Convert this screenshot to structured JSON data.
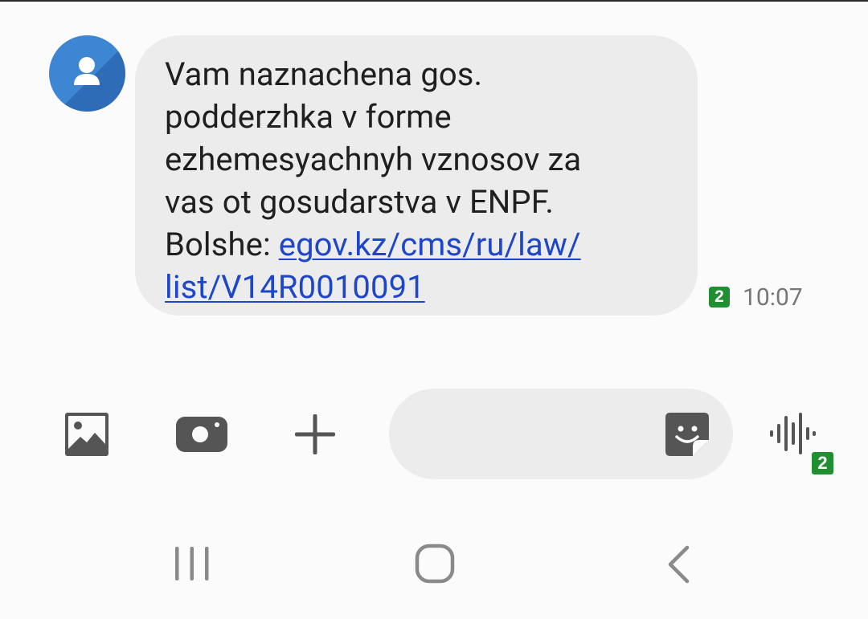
{
  "message": {
    "lines": [
      "Vam naznachena gos.",
      "podderzhka v forme",
      "ezhemesyachnyh vznosov za",
      "vas ot gosudarstva v ENPF."
    ],
    "more_prefix": "Bolshe: ",
    "link_line1": "egov.kz/cms/ru/law/",
    "link_line2": "list/V14R0010091",
    "sim_number": "2",
    "time": "10:07"
  },
  "composer": {
    "input_value": "",
    "voice_sim_number": "2"
  },
  "colors": {
    "avatar": "#3d86d4",
    "bubble": "#ececec",
    "link": "#1d46c8",
    "sim_badge": "#1f8f32",
    "icon": "#555555"
  },
  "icons": {
    "avatar": "person-icon",
    "gallery": "image-icon",
    "camera": "camera-icon",
    "attach": "plus-icon",
    "sticker": "sticker-icon",
    "voice": "voice-wave-icon",
    "nav_recents": "recents-icon",
    "nav_home": "home-icon",
    "nav_back": "back-icon"
  }
}
